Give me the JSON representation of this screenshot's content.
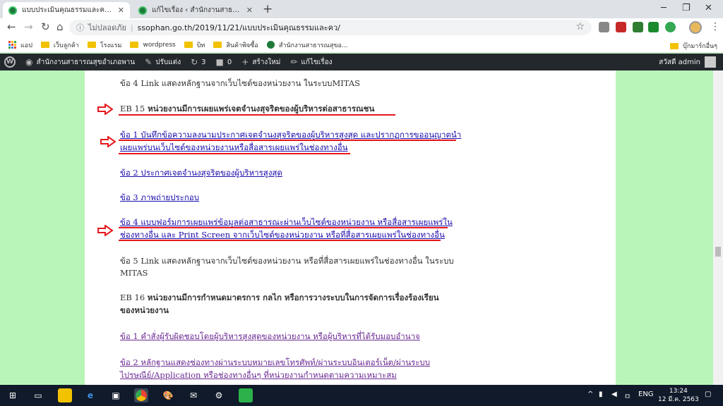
{
  "browser": {
    "tabs": [
      {
        "title": "แบบประเมินคุณธรรมและความโปร่งใสใน",
        "active": true
      },
      {
        "title": "แก้ไขเรื่อง ‹ สำนักงานสาธารณสุขอำเภ",
        "active": false
      }
    ],
    "new_tab": "+",
    "insecure_label": "ไม่ปลอดภัย",
    "url": "ssophan.go.th/2019/11/21/แบบประเมินคุณธรรมและคว/",
    "bookmarks": [
      "แอป",
      "เว็บลูกค้า",
      "โรงแรม",
      "wordpress",
      "บิท",
      "สินค้าพิจซื้อ",
      "สำนักงานสาธารณสุขอ..."
    ],
    "bookmarks_other": "บุ๊กมาร์กอื่นๆ"
  },
  "adminbar": {
    "site": "สำนักงานสาธารณสุขอำเภอพาน",
    "customize": "ปรับแต่ง",
    "updates": "3",
    "comments": "0",
    "new": "สร้างใหม่",
    "edit": "แก้ไขเรื่อง",
    "greeting": "สวัสดี admin"
  },
  "content": {
    "l1": "ข้อ 4 Link แสดงหลักฐานจากเว็บไซต์ของหน่วยงาน ในระบบMITAS",
    "eb15_code": "EB 15",
    "eb15_title": "หน่วยงานมีการเผยแพร่เจตจำนงสุจริตของผู้บริหารต่อสาธารณชน",
    "l3a": "ข้อ 1 บันทึกข้อความลงนามประกาศเจตจำนงสุจริตของผู้บริหารสูงสุด และปรากฏการขออนุญาตนำ",
    "l3b": "เผยแพร่บนเว็บไซต์ของหน่วยงานหรือสื่อสารเผยแพร่ในช่องทางอื่น",
    "l4": "ข้อ 2 ประกาศเจตจำนงสุจริตของผู้บริหารสูงสุด",
    "l5": "ข้อ 3 ภาพถ่ายประกอบ",
    "l6a": "ข้อ 4 แบบฟอร์มการเผยแพร่ข้อมูลต่อสาธารณะผ่านเว็บไซต์ของหน่วยงาน หรือสื่อสารเผยแพร่ใน",
    "l6b": "ช่องทางอื่น และ Print Screen จากเว็บไซต์ของหน่วยงาน หรือที่สื่อสารเผยแพร่ในช่องทางอื่น",
    "l7a": "ข้อ 5 Link แสดงหลักฐานจากเว็บไซต์ของหน่วยงาน หรือที่สื่อสารเผยแพร่ในช่องทางอื่น ในระบบ",
    "l7b": "MITAS",
    "eb16_code": "EB 16",
    "eb16_title_a": "หน่วยงานมีการกำหนดมาตรการ กลไก หรือการวางระบบในการจัดการเรื่องร้องเรียน",
    "eb16_title_b": "ของหน่วยงาน",
    "l9": "ข้อ 1 คำสั่งผู้รับผิดชอบโดยผู้บริหารสูงสุดของหน่วยงาน หรือผู้บริหารที่ได้รับมอบอำนาจ",
    "l10a": "ข้อ 2 หลักฐานแสดงช่องทางผ่านระบบหมายเลขโทรศัพท์/ผ่านระบบอินเตอร์เน็ต/ผ่านระบบ",
    "l10b": "ไปรษณีย์/Application หรือช่องทางอื่นๆ ที่หน่วยงานกำหนดตามความเหมาะสม"
  },
  "taskbar": {
    "lang": "ENG",
    "time": "13:24",
    "date": "12 มี.ค. 2563"
  },
  "colors": {
    "page_bg": "#b9f5b9",
    "link": "#1a0dab",
    "visited": "#6b2a93",
    "annotation": "#e6171c",
    "adminbar": "#23282d",
    "taskbar": "#101a2a"
  }
}
